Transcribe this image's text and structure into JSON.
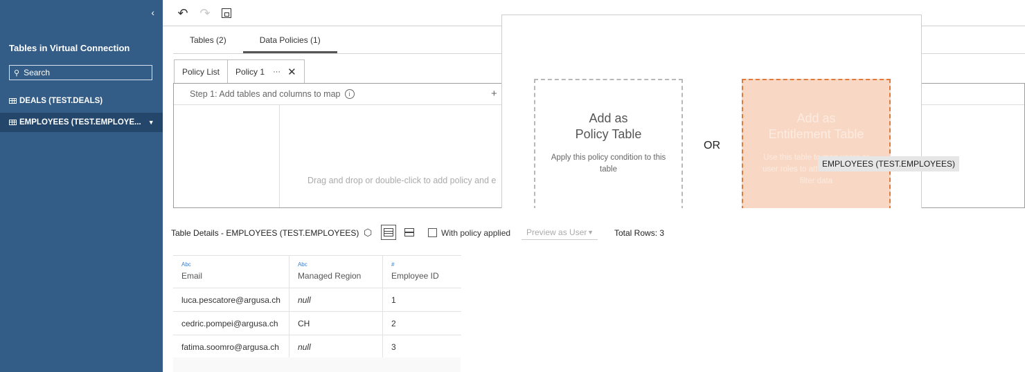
{
  "sidebar": {
    "collapse_icon": "chevron-left-icon",
    "title": "Tables in Virtual Connection",
    "search_placeholder": "Search",
    "items": [
      {
        "label": "DEALS (TEST.DEALS)",
        "icon": "table-icon",
        "selected": false
      },
      {
        "label": "EMPLOYEES (TEST.EMPLOYE...",
        "icon": "table-icon",
        "selected": true
      }
    ]
  },
  "toolbar": {
    "undo_icon": "↶",
    "redo_icon": "↷"
  },
  "tabs": [
    {
      "label": "Tables (2)",
      "active": false
    },
    {
      "label": "Data Policies (1)",
      "active": true
    }
  ],
  "subtabs": {
    "policy_list": "Policy List",
    "policy1": "Policy 1",
    "dots": "···",
    "close": "✕"
  },
  "policy_panel": {
    "step1": "Step 1: Add tables and columns to map",
    "info": "i",
    "plus": "+",
    "drop_hint": "Drag and drop or double-click to add policy and e"
  },
  "dialog": {
    "policy_title_1": "Add as",
    "policy_title_2": "Policy Table",
    "policy_desc": "Apply this policy condition to this table",
    "or_label": "OR",
    "entitlement_title_1": "Add as",
    "entitlement_title_2": "Entitlement Table",
    "entitlement_desc": "Use this table to map users or user roles to attributes used to filter data",
    "drag_chip": "EMPLOYEES (TEST.EMPLOYEES)"
  },
  "details": {
    "title": "Table Details - EMPLOYEES (TEST.EMPLOYEES)",
    "tag_icon": "⬡",
    "with_policy_label": "With policy applied",
    "preview_label": "Preview as User",
    "preview_arrow": "▼",
    "total_rows": "Total Rows: 3"
  },
  "table": {
    "columns": [
      {
        "type": "Abc",
        "name": "Email"
      },
      {
        "type": "Abc",
        "name": "Managed Region"
      },
      {
        "type": "#",
        "name": "Employee ID"
      }
    ],
    "rows": [
      [
        "luca.pescatore@argusa.ch",
        "null",
        "1"
      ],
      [
        "cedric.pompei@argusa.ch",
        "CH",
        "2"
      ],
      [
        "fatima.soomro@argusa.ch",
        "null",
        "3"
      ]
    ]
  }
}
